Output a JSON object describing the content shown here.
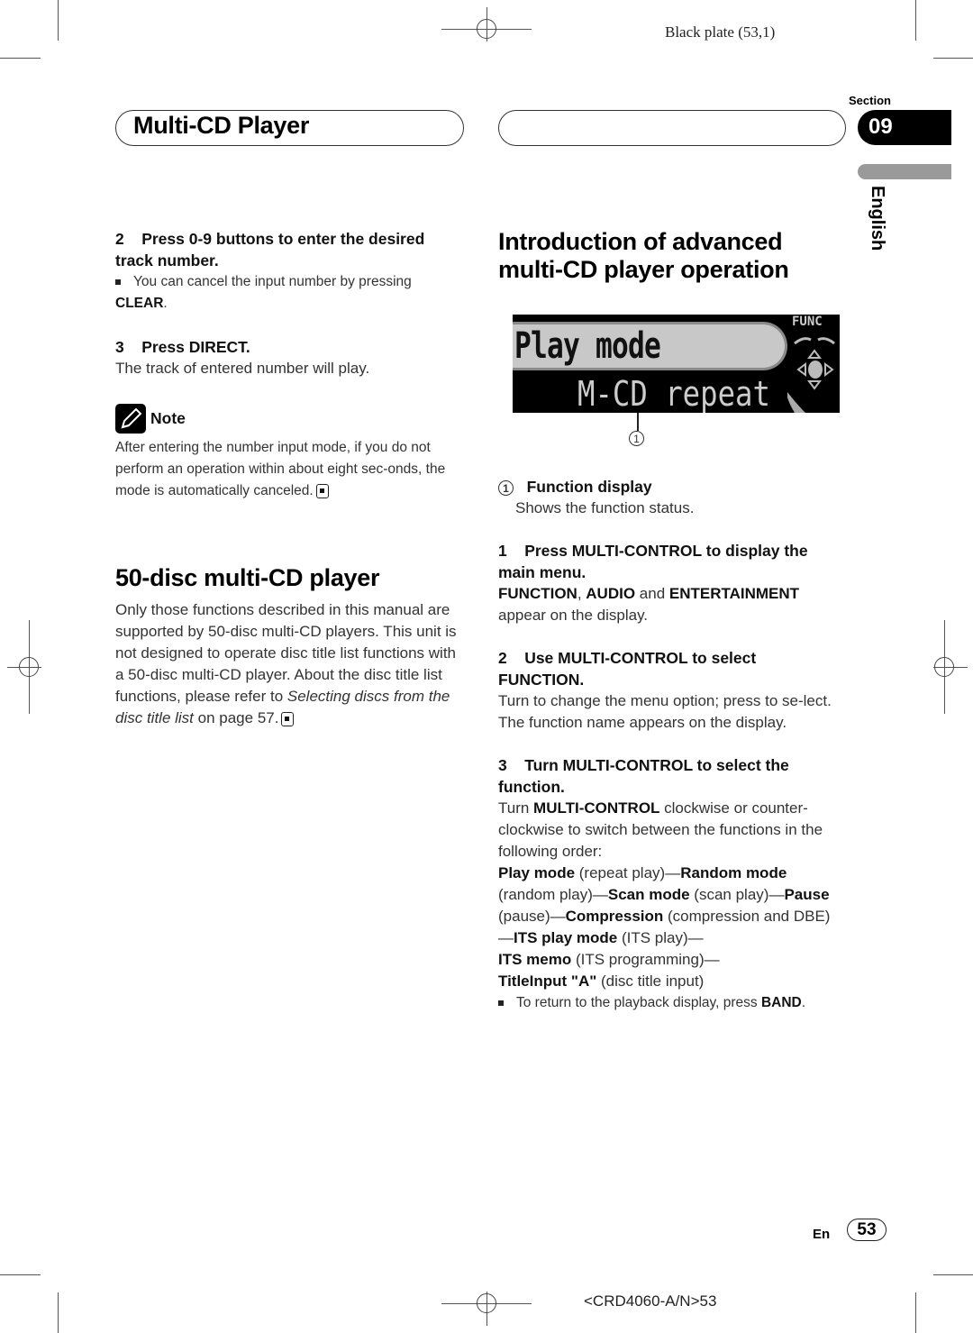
{
  "print_marks": {
    "plate": "Black plate (53,1)",
    "footer_code": "<CRD4060-A/N>53"
  },
  "header": {
    "title": "Multi-CD Player",
    "section_label": "Section",
    "section_number": "09",
    "language": "English"
  },
  "left": {
    "step2": {
      "num": "2",
      "title": "Press 0-9 buttons to enter the desired track number.",
      "bullet_text": "You can cancel the input number by pressing ",
      "bullet_bold": "CLEAR",
      "bullet_end": "."
    },
    "step3": {
      "num": "3",
      "title": "Press DIRECT.",
      "body": "The track of entered number will play."
    },
    "note": {
      "label": "Note",
      "body": "After entering the number input mode, if you do not perform an operation within about eight sec-onds, the mode is automatically canceled."
    },
    "fifty": {
      "heading": "50-disc multi-CD player",
      "body": "Only those functions described in this manual are supported by 50-disc multi-CD players. This unit is not designed to operate disc title list functions with a 50-disc multi-CD player. About the disc title list functions, please refer to ",
      "link_italic": "Selecting discs from the disc title list",
      "body_end": " on page 57."
    }
  },
  "right": {
    "heading": "Introduction of advanced multi-CD player operation",
    "display": {
      "line1": "Play mode",
      "line2": "M-CD repeat",
      "func_label": "FUNC",
      "callout": "1"
    },
    "callout_item": {
      "num": "1",
      "title": "Function display",
      "body": "Shows the function status."
    },
    "step1": {
      "num": "1",
      "title": "Press MULTI-CONTROL to display the main menu.",
      "b1": "FUNCTION",
      "t1": ", ",
      "b2": "AUDIO",
      "t2": " and ",
      "b3": "ENTERTAINMENT",
      "t3": " appear on the display."
    },
    "step2": {
      "num": "2",
      "title": "Use MULTI-CONTROL to select FUNCTION.",
      "body1": "Turn to change the menu option; press to se-lect.",
      "body2": "The function name appears on the display."
    },
    "step3": {
      "num": "3",
      "title": "Turn MULTI-CONTROL to select the function.",
      "intro_a": "Turn ",
      "intro_bold": "MULTI-CONTROL",
      "intro_b": " clockwise or counter-clockwise to switch between the functions in the following order:",
      "order": [
        {
          "name": "Play mode",
          "desc": " (repeat play)—"
        },
        {
          "name": "Random mode",
          "desc": " (random play)—"
        },
        {
          "name": "Scan mode",
          "desc": " (scan play)—"
        },
        {
          "name": "Pause",
          "desc": " (pause)—"
        },
        {
          "name": "Compression",
          "desc": " (compression and DBE)—"
        },
        {
          "name": "ITS play mode",
          "desc": " (ITS play)—"
        },
        {
          "name": "ITS memo",
          "desc": " (ITS programming)—"
        },
        {
          "name": "TitleInput \"A\"",
          "desc": " (disc title input)"
        }
      ],
      "bullet_text": "To return to the playback display, press ",
      "bullet_bold": "BAND",
      "bullet_end": "."
    }
  },
  "page": {
    "lang_code": "En",
    "number": "53"
  }
}
